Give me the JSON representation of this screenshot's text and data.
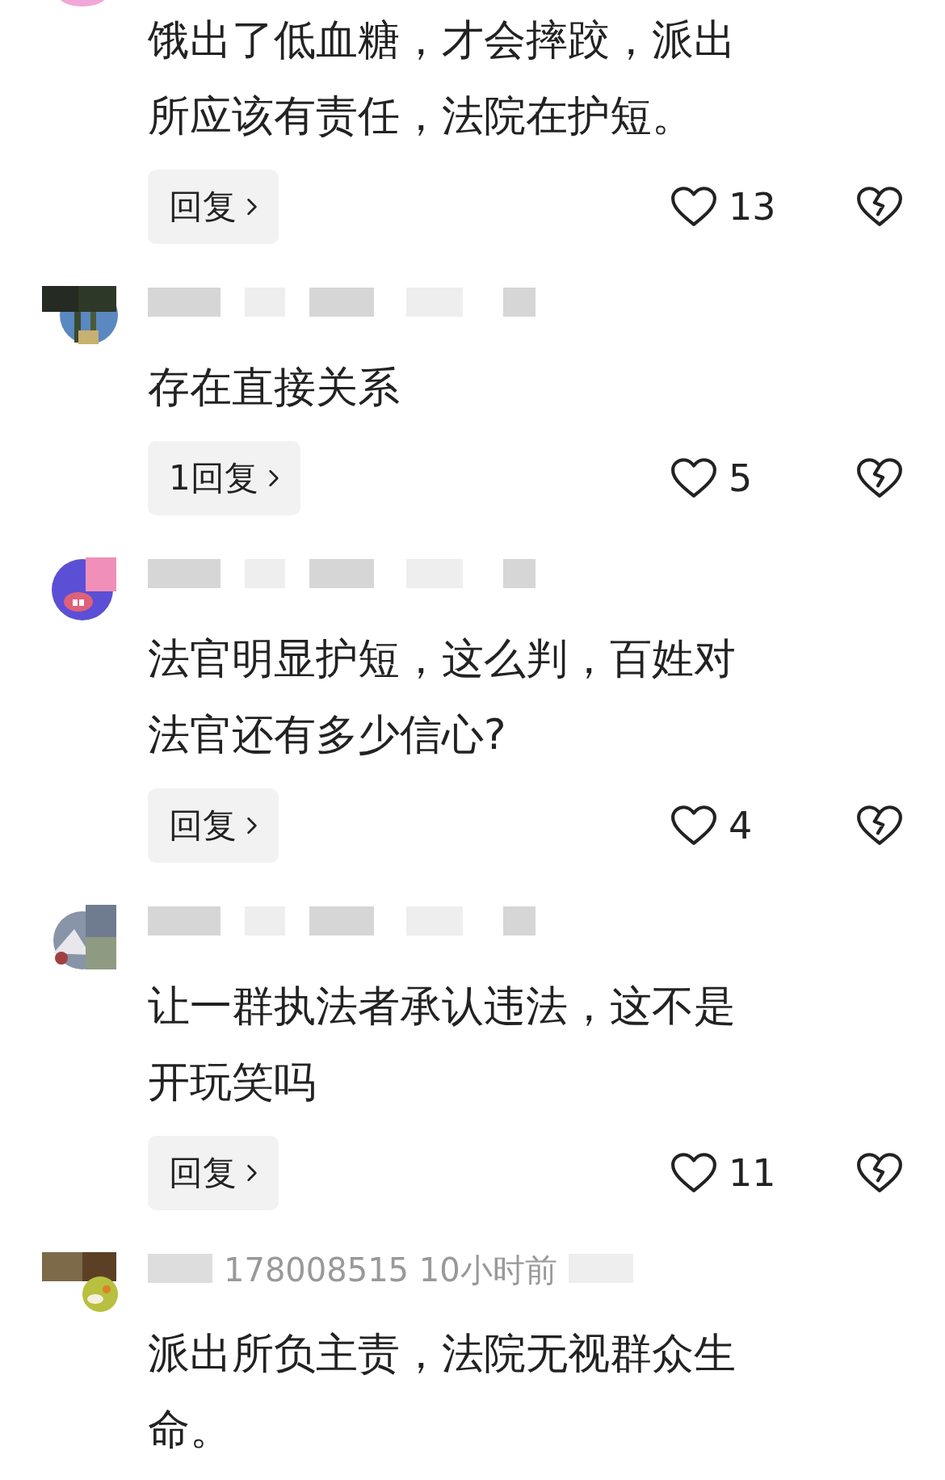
{
  "comments": [
    {
      "kind": "pink-edge",
      "text": "饿出了低血糖，才会摔跤，派出所应该有责任，法院在护短。",
      "reply": "回复",
      "likes": "13"
    },
    {
      "kind": "palms",
      "text": "存在直接关系",
      "reply": "1回复",
      "likes": "5"
    },
    {
      "kind": "cartoon",
      "text": "法官明显护短，这么判，百姓对法官还有多少信心?",
      "reply": "回复",
      "likes": "4"
    },
    {
      "kind": "landscape",
      "text": "让一群执法者承认违法，这不是开玩笑吗",
      "reply": "回复",
      "likes": "11"
    },
    {
      "kind": "food",
      "meta": "178008515  10小时前",
      "text": "派出所负主责，法院无视群众生命。"
    }
  ]
}
